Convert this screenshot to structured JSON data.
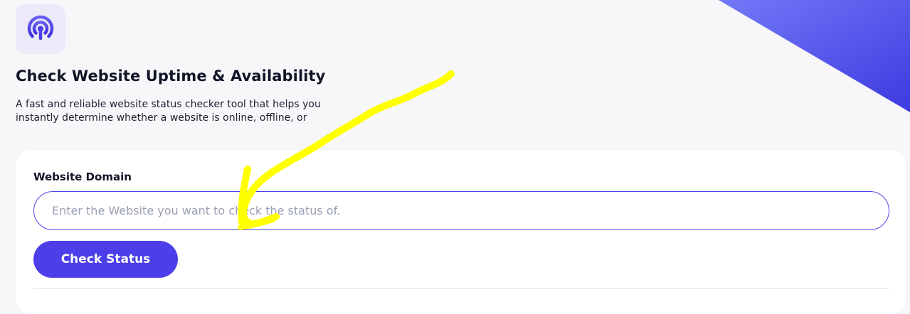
{
  "header": {
    "logo_icon": "broadcast-signal-icon",
    "title": "Check Website Uptime & Availability",
    "description": "A fast and reliable website status checker tool that helps you instantly determine whether a website is online, offline, or"
  },
  "form": {
    "label": "Website Domain",
    "input_value": "",
    "input_placeholder": "Enter the Website you want to check the status of.",
    "button_label": "Check Status"
  },
  "annotation": {
    "type": "yellow-hand-drawn-arrow",
    "points_to": "domain-input"
  },
  "colors": {
    "accent": "#4c3ee8",
    "logo_bg": "#eceaf8",
    "page_bg": "#f7f7f9",
    "card_bg": "#ffffff",
    "corner_gradient_start": "#6b6cf6",
    "corner_gradient_end": "#3f3ce0",
    "annotation": "#ffff00"
  }
}
